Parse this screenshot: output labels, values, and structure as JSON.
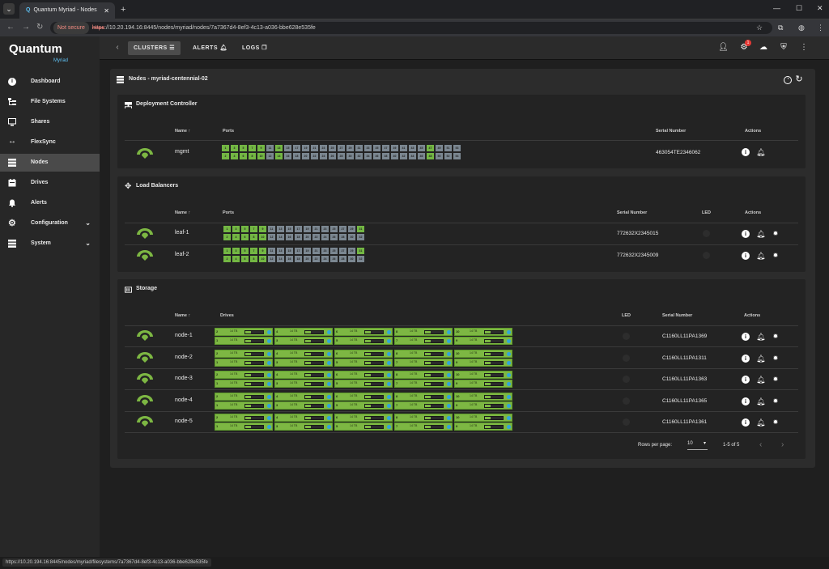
{
  "browser": {
    "tab_title": "Quantum Myriad - Nodes",
    "not_secure": "Not secure",
    "url_scheme": "https",
    "url_rest": "://10.20.194.16:8445/nodes/myriad/nodes/7a7367d4-8ef3-4c13-a036-bbe628e535fe",
    "status_url": "https://10.20.194.16:8445/nodes/myriad/filesystems/7a7367d4-8ef3-4c13-a036-bbe628e535fe"
  },
  "brand": {
    "name": "Quantum",
    "product": "Myriad"
  },
  "sidebar": {
    "items": [
      {
        "label": "Dashboard"
      },
      {
        "label": "File Systems"
      },
      {
        "label": "Shares"
      },
      {
        "label": "FlexSync"
      },
      {
        "label": "Nodes"
      },
      {
        "label": "Drives"
      },
      {
        "label": "Alerts"
      },
      {
        "label": "Configuration"
      },
      {
        "label": "System"
      }
    ]
  },
  "topbar": {
    "clusters": "CLUSTERS",
    "alerts": "ALERTS",
    "logs": "LOGS",
    "badge": "1"
  },
  "page": {
    "title": "Nodes - myriad-centennial-02"
  },
  "deployment": {
    "title": "Deployment Controller",
    "col_name": "Name",
    "col_ports": "Ports",
    "col_serial": "Serial Number",
    "col_actions": "Actions",
    "rows": [
      {
        "name": "mgmt",
        "serial": "463054TE2346062",
        "ports": [
          "1",
          "2",
          "3",
          "4",
          "5",
          "6",
          "7",
          "8",
          "9",
          "10",
          "11",
          "12",
          "13",
          "14",
          "15",
          "16",
          "17",
          "18",
          "19",
          "20",
          "21",
          "22",
          "23",
          "24",
          "25",
          "26",
          "27",
          "28",
          "29",
          "30",
          "31",
          "32",
          "33",
          "34",
          "35",
          "36",
          "37",
          "38",
          "39",
          "40",
          "41",
          "42",
          "43",
          "44",
          "45",
          "46",
          "47",
          "48",
          "49",
          "50",
          "51",
          "52",
          "53",
          "54"
        ],
        "on": [
          "1",
          "2",
          "3",
          "4",
          "5",
          "6",
          "7",
          "8",
          "9",
          "10",
          "13",
          "14",
          "47",
          "48"
        ]
      }
    ]
  },
  "loadbalancers": {
    "title": "Load Balancers",
    "col_name": "Name",
    "col_ports": "Ports",
    "col_serial": "Serial Number",
    "col_led": "LED",
    "col_actions": "Actions",
    "rows": [
      {
        "name": "leaf-1",
        "serial": "772632X2345015",
        "ports": [
          "1",
          "2",
          "3",
          "4",
          "5",
          "6",
          "7",
          "8",
          "9",
          "10",
          "11",
          "12",
          "13",
          "14",
          "15",
          "16",
          "17",
          "18",
          "19",
          "20",
          "21",
          "22",
          "23",
          "24",
          "25",
          "26",
          "27",
          "28",
          "29",
          "30",
          "31",
          "32"
        ],
        "on": [
          "1",
          "2",
          "3",
          "4",
          "5",
          "6",
          "7",
          "8",
          "9",
          "10",
          "31"
        ]
      },
      {
        "name": "leaf-2",
        "serial": "772632X2345009",
        "ports": [
          "1",
          "2",
          "3",
          "4",
          "5",
          "6",
          "7",
          "8",
          "9",
          "10",
          "11",
          "12",
          "13",
          "14",
          "15",
          "16",
          "17",
          "18",
          "19",
          "20",
          "21",
          "22",
          "23",
          "24",
          "25",
          "26",
          "27",
          "28",
          "29",
          "30",
          "31",
          "32"
        ],
        "on": [
          "1",
          "2",
          "3",
          "4",
          "5",
          "6",
          "7",
          "8",
          "9",
          "10",
          "31"
        ]
      }
    ]
  },
  "storage": {
    "title": "Storage",
    "col_name": "Name",
    "col_drives": "Drives",
    "col_led": "LED",
    "col_serial": "Serial Number",
    "col_actions": "Actions",
    "drive_cap": "14 TB",
    "drive_slots": [
      "2",
      "4",
      "6",
      "8",
      "10",
      "1",
      "3",
      "5",
      "7",
      "9"
    ],
    "rows": [
      {
        "name": "node-1",
        "serial": "C1160LL11PA1369"
      },
      {
        "name": "node-2",
        "serial": "C1160LL11PA1311"
      },
      {
        "name": "node-3",
        "serial": "C1160LL11PA1363"
      },
      {
        "name": "node-4",
        "serial": "C1160LL11PA1365"
      },
      {
        "name": "node-5",
        "serial": "C1160LL11PA1361"
      }
    ]
  },
  "pagination": {
    "rows_per_page_label": "Rows per page:",
    "rows_per_page": "10",
    "range": "1-5 of 5"
  },
  "colors": {
    "port_on": "#73b743",
    "port_off": "#7b8791",
    "drive": "#7db743",
    "accent": "#5ec0f2"
  }
}
